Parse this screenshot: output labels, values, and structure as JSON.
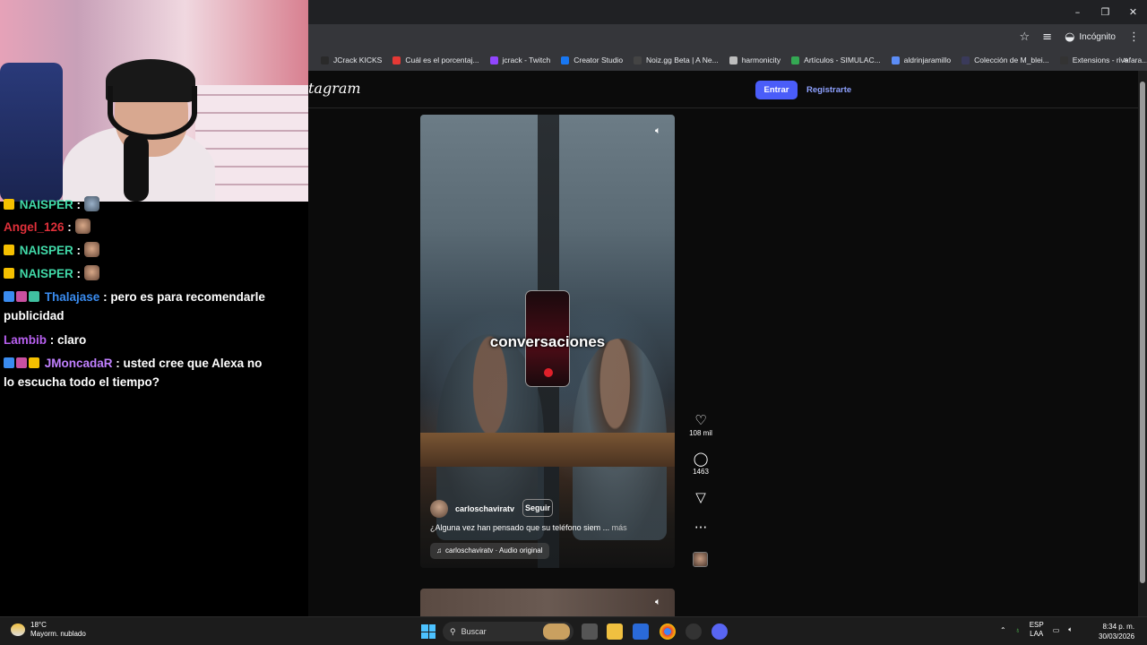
{
  "window": {
    "controls": [
      "–",
      "❐",
      "✕"
    ],
    "incognito_label": "Incógnito"
  },
  "bookmarks": [
    {
      "label": "JCrack KICKS",
      "color": "#2a2a2a"
    },
    {
      "label": "Cuál es el porcentaj...",
      "color": "#e53935"
    },
    {
      "label": "jcrack - Twitch",
      "color": "#9146ff"
    },
    {
      "label": "Creator Studio",
      "color": "#1877f2"
    },
    {
      "label": "Noiz.gg Beta | A Ne...",
      "color": "#444444"
    },
    {
      "label": "harmonicity",
      "color": "#bdbdbd"
    },
    {
      "label": "Artículos - SIMULAC...",
      "color": "#34a853"
    },
    {
      "label": "aldrinjaramillo",
      "color": "#5c8df6"
    },
    {
      "label": "Colección de M_blei...",
      "color": "#3a3a5a"
    },
    {
      "label": "Extensions - rivafara...",
      "color": "#333333"
    }
  ],
  "instagram": {
    "logo_partial": "tagram",
    "login_label": "Entrar",
    "signup_label": "Registrarte"
  },
  "reel": {
    "overlay_word": "conversaciones",
    "username": "carloschaviratv",
    "follow_label": "Seguir",
    "description": "¿Alguna vez han pensado que su teléfono siem ... ",
    "more_label": "más",
    "audio_label": "carloschaviratv · Audio original",
    "likes": "108 mil",
    "comments": "1463"
  },
  "chat": [
    {
      "user": "NAISPER",
      "text": "",
      "emote": true
    },
    {
      "user": "Angel_126",
      "text": "",
      "emote": true
    },
    {
      "user": "NAISPER",
      "text": "",
      "emote": true
    },
    {
      "user": "NAISPER",
      "text": "",
      "emote": true
    },
    {
      "user": "Thalajase",
      "text": "pero es para recomendarle publicidad"
    },
    {
      "user": "Lambib",
      "text": "claro"
    },
    {
      "user": "JMoncadaR",
      "text": "usted cree que Alexa no lo escucha todo el tiempo?"
    }
  ],
  "taskbar": {
    "temperature": "18°C",
    "weather": "Mayorm. nublado",
    "search_placeholder": "Buscar",
    "lang_top": "ESP",
    "lang_bottom": "LAA",
    "time": "8:34 p. m.",
    "date": "30/03/2026"
  },
  "colors": {
    "accent_blue": "#4a5df9",
    "link_blue": "#8ea1ff",
    "naisper": "#41d9a8",
    "angel": "#e0303a",
    "thalajase": "#3a8cf0",
    "lambib": "#b860f0",
    "jmoncadar": "#c080ff"
  }
}
